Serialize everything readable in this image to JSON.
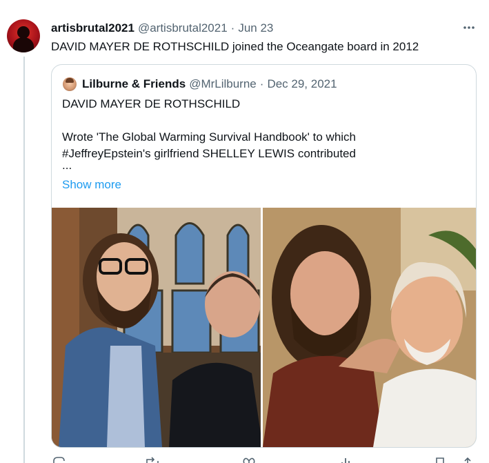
{
  "tweet": {
    "author_name": "artisbrutal2021",
    "author_handle": "@artisbrutal2021",
    "separator": "·",
    "date": "Jun 23",
    "text": "DAVID MAYER DE ROTHSCHILD joined the Oceangate board in 2012",
    "more_icon": "more-horizontal-icon"
  },
  "quote": {
    "author_name": "Lilburne & Friends",
    "author_handle": "@MrLilburne",
    "separator": "·",
    "date": "Dec 29, 2021",
    "lines": [
      "DAVID MAYER DE ROTHSCHILD",
      "",
      "Wrote 'The Global Warming Survival Handbook' to which",
      "#JeffreyEpstein's girlfriend SHELLEY LEWIS contributed",
      "..."
    ],
    "show_more": "Show more"
  },
  "actions": {
    "icons": [
      "reply-icon",
      "retweet-icon",
      "like-icon",
      "views-icon",
      "bookmark-icon",
      "share-icon"
    ]
  }
}
